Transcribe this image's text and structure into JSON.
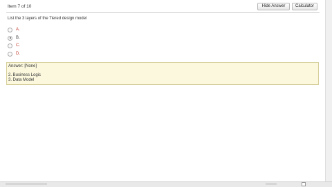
{
  "header": {
    "item_counter": "Item 7 of 10",
    "hide_answer_label": "Hide Answer",
    "calculator_label": "Calculator"
  },
  "question": {
    "text": "List the 3 layers of the Tiered design model",
    "options": [
      {
        "label": "A.",
        "checked": false
      },
      {
        "label": "B.",
        "checked": true
      },
      {
        "label": "C.",
        "checked": false
      },
      {
        "label": "D.",
        "checked": false
      }
    ]
  },
  "answer": {
    "title": "Answer: [None]",
    "lines": [
      "2. Business Logic",
      "3. Data Model"
    ]
  },
  "colors": {
    "option_text": "#c0392b",
    "answer_background": "#fbf8de",
    "answer_border": "#d6cf9c"
  }
}
